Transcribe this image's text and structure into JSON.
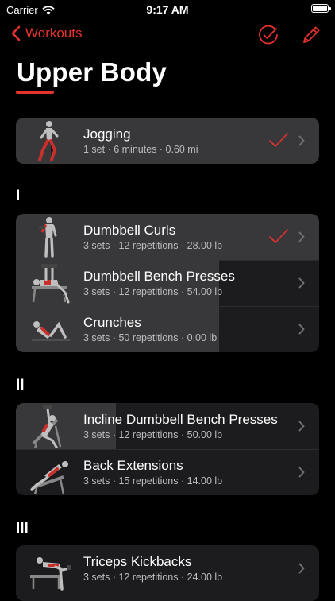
{
  "status": {
    "carrier": "Carrier",
    "time": "9:17 AM"
  },
  "nav": {
    "back_label": "Workouts"
  },
  "title": "Upper Body",
  "colors": {
    "accent": "#e5322c",
    "row_bg": "#1c1c1e",
    "progress_bg": "#38383a",
    "muscle_highlight": "#c9302c"
  },
  "warmup": [
    {
      "name": "Jogging",
      "detail": "1 set · 6 minutes · 0.60 mi",
      "completed": true,
      "progress": 1.0,
      "icon": "runner-figure"
    }
  ],
  "sections": [
    {
      "label": "I",
      "exercises": [
        {
          "name": "Dumbbell Curls",
          "detail": "3 sets · 12 repetitions · 28.00 lb",
          "completed": true,
          "progress": 1.0,
          "icon": "dumbbell-curl-figure"
        },
        {
          "name": "Dumbbell Bench Presses",
          "detail": "3 sets · 12 repetitions · 54.00 lb",
          "completed": false,
          "progress": 0.67,
          "icon": "bench-press-figure"
        },
        {
          "name": "Crunches",
          "detail": "3 sets · 50 repetitions · 0.00 lb",
          "completed": false,
          "progress": 0.67,
          "icon": "crunch-figure"
        }
      ]
    },
    {
      "label": "II",
      "exercises": [
        {
          "name": "Incline Dumbbell Bench Presses",
          "detail": "3 sets · 12 repetitions · 50.00 lb",
          "completed": false,
          "progress": 0.33,
          "icon": "incline-press-figure"
        },
        {
          "name": "Back Extensions",
          "detail": "3 sets · 15 repetitions · 14.00 lb",
          "completed": false,
          "progress": 0.0,
          "icon": "back-extension-figure"
        }
      ]
    },
    {
      "label": "III",
      "exercises": [
        {
          "name": "Triceps Kickbacks",
          "detail": "3 sets · 12 repetitions · 24.00 lb",
          "completed": false,
          "progress": 0.0,
          "icon": "kickback-figure"
        }
      ]
    }
  ]
}
